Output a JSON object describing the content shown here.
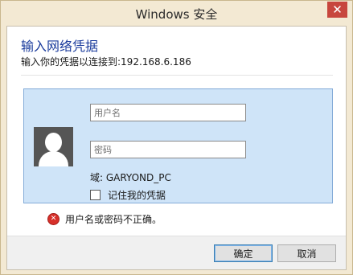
{
  "window": {
    "title": "Windows 安全",
    "close_glyph": "✕"
  },
  "dialog": {
    "heading": "输入网络凭据",
    "subheading": "输入你的凭据以连接到:192.168.6.186"
  },
  "credentials": {
    "username_placeholder": "用户名",
    "password_placeholder": "密码",
    "domain_text": "域: GARYOND_PC",
    "remember_label": "记住我的凭据",
    "remember_checked": false
  },
  "error": {
    "icon": "error-x-icon",
    "icon_glyph": "✕",
    "message": "用户名或密码不正确。"
  },
  "buttons": {
    "ok_label": "确定",
    "cancel_label": "取消"
  },
  "colors": {
    "title_bg": "#f3e9d3",
    "close_bg": "#c7463d",
    "heading": "#1a3b9c",
    "tile_bg": "#cfe4f8",
    "tile_border": "#84acd8",
    "error_red": "#d7302a"
  }
}
